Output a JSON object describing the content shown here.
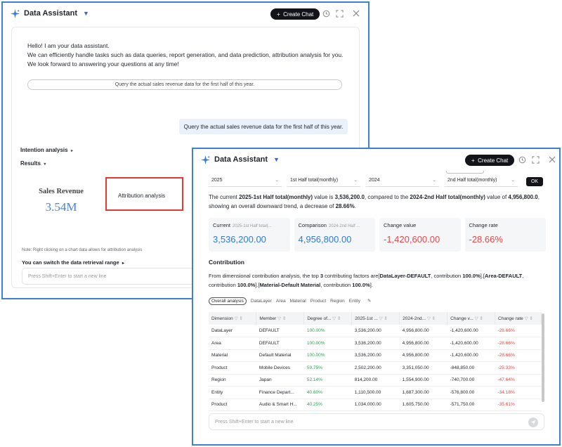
{
  "back_window": {
    "title": "Data Assistant",
    "create_chat": "Create Chat",
    "greeting": [
      "Hello! I am your data assistant.",
      "We can efficiently handle tasks such as data queries, report generation, and data prediction, attribution analysis for you.",
      "We look forward to answering your questions at any time!"
    ],
    "suggestion": "Query the actual sales revenue data for the first half of this year.",
    "user_query": "Query the actual sales revenue data for the first half of this year.",
    "intention_label": "Intention analysis",
    "results_label": "Results",
    "sales_title": "Sales Revenue",
    "sales_value": "3.54M",
    "context_menu_item": "Attribution analysis",
    "note": "Note: Right clicking on a chart data allows for attribution analysis",
    "switch_text": "You can switch the data retrieval range",
    "input_placeholder": "Press Shift+Enter to start a new line"
  },
  "front_window": {
    "title": "Data Assistant",
    "create_chat": "Create Chat",
    "filters": [
      "2025",
      "1st Half total(monthly)",
      "2024",
      "2nd Half total(monthly)"
    ],
    "ok_label": "OK",
    "summary": {
      "p1": "The current ",
      "b1": "2025-1st Half total(monthly)",
      "p2": " value is ",
      "b2": "3,536,200.0",
      "p3": ", compared to the ",
      "b3": "2024-2nd Half total(monthly)",
      "p4": " value of ",
      "b4": "4,956,800.0",
      "p5": ", showing an overall downward trend, a decrease of ",
      "b5": "28.66%",
      "p6": "."
    },
    "cards": [
      {
        "label": "Current",
        "sub": "2025-1st Half total(...",
        "value": "3,536,200.00",
        "tone": "blue"
      },
      {
        "label": "Comparison",
        "sub": "2024-2nd Half ...",
        "value": "4,956,800.00",
        "tone": "blue"
      },
      {
        "label": "Change value",
        "sub": "",
        "value": "-1,420,600.00",
        "tone": "red"
      },
      {
        "label": "Change rate",
        "sub": "",
        "value": "-28.66%",
        "tone": "red"
      }
    ],
    "contribution_title": "Contribution",
    "contribution": {
      "p1": "From dimensional contribution analysis, the top ",
      "b1": "3",
      "p2": " contributing factors are[",
      "b2": "DataLayer-DEFAULT",
      "p3": ", contribution ",
      "b3": "100.0%",
      "p4": "].[",
      "b4": "Area-DEFAULT",
      "p5": ", contribution ",
      "b5": "100.0%",
      "p6": "].[",
      "b6": "Material-Default Material",
      "p7": ", contribution ",
      "b7": "100.0%",
      "p8": "]."
    },
    "tabs": [
      "Overall analysis",
      "DataLayer",
      "Area",
      "Material",
      "Product",
      "Region",
      "Entity"
    ],
    "columns": [
      "Dimension",
      "Member",
      "Degree of...",
      "2025-1st ...",
      "2024-2nd...",
      "Change v...",
      "Change rate"
    ],
    "rows": [
      [
        "DataLayer",
        "DEFAULT",
        "100.00%",
        "3,536,200.00",
        "4,956,800.00",
        "-1,420,600.00",
        "-28.66%"
      ],
      [
        "Area",
        "DEFAULT",
        "100.00%",
        "3,536,200.00",
        "4,956,800.00",
        "-1,420,600.00",
        "-28.66%"
      ],
      [
        "Material",
        "Default Material",
        "100.00%",
        "3,536,200.00",
        "4,956,800.00",
        "-1,420,600.00",
        "-28.66%"
      ],
      [
        "Product",
        "Mobile Devices",
        "59.75%",
        "2,502,200.00",
        "3,351,050.00",
        "-848,850.00",
        "-25.33%"
      ],
      [
        "Region",
        "Japan",
        "52.14%",
        "814,200.00",
        "1,554,900.00",
        "-740,700.00",
        "-47.64%"
      ],
      [
        "Entity",
        "Finance Depart...",
        "40.60%",
        "1,110,500.00",
        "1,687,300.00",
        "-576,800.00",
        "-34.18%"
      ],
      [
        "Product",
        "Audio & Smart H...",
        "40.25%",
        "1,034,000.00",
        "1,605,750.00",
        "-571,750.00",
        "-35.61%"
      ]
    ],
    "input_placeholder": "Press Shift+Enter to start a new line"
  }
}
